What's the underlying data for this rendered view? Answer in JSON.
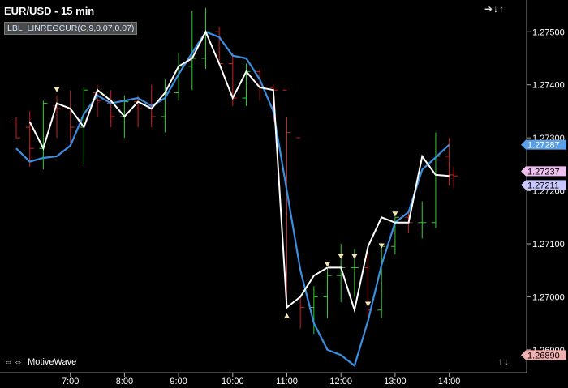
{
  "header": {
    "title": "EUR/USD - 15 min",
    "study_label": "LBL_LINREGCUR(C,9,0.07,0.07)"
  },
  "footer": {
    "brand": "MotiveWave",
    "left_nav_icons": "⇔ ⇔",
    "brand_icon": "double-arrow-icon"
  },
  "navigation": {
    "top_right": "➔↓↑",
    "bottom_right": "↑↓"
  },
  "colors": {
    "background": "#000000",
    "price_line": "#ffffff",
    "regression_line": "#3b8fe0",
    "up_bar": "#33cc33",
    "down_bar": "#cc2222",
    "axis_text": "#ffffff",
    "current_price_badge": "#5aa0e8",
    "upper_badge": "#f0c0f0",
    "lower_badge": "#c8c8ff",
    "low_badge": "#f0b0b0"
  },
  "chart_data": {
    "type": "line",
    "symbol": "EUR/USD",
    "timeframe": "15 min",
    "x_ticks": [
      "7:00",
      "8:00",
      "9:00",
      "10:00",
      "11:00",
      "12:00",
      "13:00",
      "14:00"
    ],
    "y_ticks": [
      "1.27500",
      "1.27400",
      "1.27300",
      "1.27200",
      "1.27100",
      "1.27000",
      "1.26900"
    ],
    "ylim": [
      1.2689,
      1.2755
    ],
    "price_labels": {
      "regression_last": "1.27287",
      "upper": "1.27237",
      "lower": "1.27211",
      "low": "1.26890"
    },
    "series": [
      {
        "name": "Close",
        "x": [
          "6:15",
          "6:30",
          "6:45",
          "7:00",
          "7:15",
          "7:30",
          "7:45",
          "8:00",
          "8:15",
          "8:30",
          "8:45",
          "9:00",
          "9:15",
          "9:30",
          "9:45",
          "10:00",
          "10:15",
          "10:30",
          "10:45",
          "11:00",
          "11:15",
          "11:30",
          "11:45",
          "12:00",
          "12:15",
          "12:30",
          "12:45",
          "13:00",
          "13:15",
          "13:30",
          "13:45",
          "14:00"
        ],
        "values": [
          1.2733,
          1.2728,
          1.27365,
          1.27355,
          1.2732,
          1.2739,
          1.2737,
          1.2734,
          1.27368,
          1.27355,
          1.27385,
          1.27435,
          1.2745,
          1.275,
          1.2744,
          1.27375,
          1.27425,
          1.27395,
          1.2739,
          1.2698,
          1.27,
          1.2704,
          1.27055,
          1.27055,
          1.26975,
          1.27095,
          1.2715,
          1.2714,
          1.2714,
          1.27265,
          1.2723,
          1.27228
        ]
      },
      {
        "name": "LBL_LINREGCUR",
        "x": [
          "6:00",
          "6:15",
          "6:30",
          "6:45",
          "7:00",
          "7:15",
          "7:30",
          "7:45",
          "8:00",
          "8:15",
          "8:30",
          "8:45",
          "9:00",
          "9:15",
          "9:30",
          "9:45",
          "10:00",
          "10:15",
          "10:30",
          "10:45",
          "11:00",
          "11:15",
          "11:30",
          "11:45",
          "12:00",
          "12:15",
          "12:30",
          "12:45",
          "13:00",
          "13:15",
          "13:30",
          "13:45",
          "14:00"
        ],
        "values": [
          1.2728,
          1.27255,
          1.27262,
          1.27265,
          1.27285,
          1.27345,
          1.2738,
          1.27365,
          1.2737,
          1.27375,
          1.2736,
          1.27375,
          1.2742,
          1.2746,
          1.275,
          1.2749,
          1.27455,
          1.2745,
          1.2741,
          1.2735,
          1.272,
          1.2705,
          1.2695,
          1.269,
          1.2689,
          1.2687,
          1.26955,
          1.2706,
          1.2714,
          1.2716,
          1.2724,
          1.27263,
          1.27287
        ]
      }
    ],
    "markers": [
      {
        "time": "6:45",
        "value": 1.2739,
        "kind": "top"
      },
      {
        "time": "11:00",
        "value": 1.26965,
        "kind": "bottom"
      },
      {
        "time": "11:45",
        "value": 1.2706,
        "kind": "top"
      },
      {
        "time": "12:00",
        "value": 1.27075,
        "kind": "top"
      },
      {
        "time": "12:15",
        "value": 1.27075,
        "kind": "top"
      },
      {
        "time": "12:30",
        "value": 1.26985,
        "kind": "top"
      },
      {
        "time": "12:45",
        "value": 1.27095,
        "kind": "top"
      },
      {
        "time": "13:00",
        "value": 1.27155,
        "kind": "top"
      }
    ],
    "bars": [
      {
        "t": "6:00",
        "o": 1.2733,
        "h": 1.2734,
        "l": 1.273,
        "c": 1.273
      },
      {
        "t": "6:15",
        "o": 1.2732,
        "h": 1.2735,
        "l": 1.27245,
        "c": 1.2728
      },
      {
        "t": "6:30",
        "o": 1.2728,
        "h": 1.2737,
        "l": 1.2724,
        "c": 1.27365
      },
      {
        "t": "6:45",
        "o": 1.2736,
        "h": 1.2738,
        "l": 1.273,
        "c": 1.27355
      },
      {
        "t": "7:00",
        "o": 1.27355,
        "h": 1.2739,
        "l": 1.2729,
        "c": 1.2732
      },
      {
        "t": "7:15",
        "o": 1.2732,
        "h": 1.27395,
        "l": 1.2725,
        "c": 1.2739
      },
      {
        "t": "7:30",
        "o": 1.27385,
        "h": 1.274,
        "l": 1.2734,
        "c": 1.2737
      },
      {
        "t": "7:45",
        "o": 1.27365,
        "h": 1.2739,
        "l": 1.2732,
        "c": 1.2734
      },
      {
        "t": "8:00",
        "o": 1.2734,
        "h": 1.2738,
        "l": 1.273,
        "c": 1.27368
      },
      {
        "t": "8:15",
        "o": 1.27368,
        "h": 1.2738,
        "l": 1.2732,
        "c": 1.27355
      },
      {
        "t": "8:30",
        "o": 1.2736,
        "h": 1.274,
        "l": 1.2732,
        "c": 1.2734
      },
      {
        "t": "8:45",
        "o": 1.2734,
        "h": 1.2741,
        "l": 1.2731,
        "c": 1.27385
      },
      {
        "t": "9:00",
        "o": 1.27385,
        "h": 1.2746,
        "l": 1.2737,
        "c": 1.27435
      },
      {
        "t": "9:15",
        "o": 1.27435,
        "h": 1.2754,
        "l": 1.2739,
        "c": 1.2745
      },
      {
        "t": "9:30",
        "o": 1.2745,
        "h": 1.27545,
        "l": 1.2743,
        "c": 1.275
      },
      {
        "t": "9:45",
        "o": 1.275,
        "h": 1.2751,
        "l": 1.2744,
        "c": 1.2744
      },
      {
        "t": "10:00",
        "o": 1.2744,
        "h": 1.2746,
        "l": 1.2736,
        "c": 1.27375
      },
      {
        "t": "10:15",
        "o": 1.27375,
        "h": 1.2744,
        "l": 1.2736,
        "c": 1.27425
      },
      {
        "t": "10:30",
        "o": 1.27425,
        "h": 1.2743,
        "l": 1.2737,
        "c": 1.27395
      },
      {
        "t": "10:45",
        "o": 1.27395,
        "h": 1.274,
        "l": 1.2733,
        "c": 1.2739
      },
      {
        "t": "11:00",
        "o": 1.2739,
        "h": 1.2734,
        "l": 1.2698,
        "c": 1.2731
      },
      {
        "t": "11:15",
        "o": 1.273,
        "h": 1.27,
        "l": 1.2694,
        "c": 1.2698
      },
      {
        "t": "11:30",
        "o": 1.2698,
        "h": 1.2702,
        "l": 1.2693,
        "c": 1.27
      },
      {
        "t": "11:45",
        "o": 1.27,
        "h": 1.2706,
        "l": 1.2696,
        "c": 1.2704
      },
      {
        "t": "12:00",
        "o": 1.2704,
        "h": 1.271,
        "l": 1.2699,
        "c": 1.27055
      },
      {
        "t": "12:15",
        "o": 1.27055,
        "h": 1.2709,
        "l": 1.27,
        "c": 1.27055
      },
      {
        "t": "12:30",
        "o": 1.27055,
        "h": 1.2708,
        "l": 1.2696,
        "c": 1.26975
      },
      {
        "t": "12:45",
        "o": 1.26975,
        "h": 1.271,
        "l": 1.2696,
        "c": 1.27095
      },
      {
        "t": "13:00",
        "o": 1.27095,
        "h": 1.2716,
        "l": 1.2708,
        "c": 1.2715
      },
      {
        "t": "13:15",
        "o": 1.2715,
        "h": 1.2716,
        "l": 1.2712,
        "c": 1.2714
      },
      {
        "t": "13:30",
        "o": 1.2714,
        "h": 1.2718,
        "l": 1.2711,
        "c": 1.2714
      },
      {
        "t": "13:45",
        "o": 1.2714,
        "h": 1.2731,
        "l": 1.2713,
        "c": 1.27265
      },
      {
        "t": "14:00",
        "o": 1.27265,
        "h": 1.273,
        "l": 1.2721,
        "c": 1.2723
      },
      {
        "t": "14:05",
        "o": 1.2723,
        "h": 1.27245,
        "l": 1.27205,
        "c": 1.27228
      }
    ]
  }
}
